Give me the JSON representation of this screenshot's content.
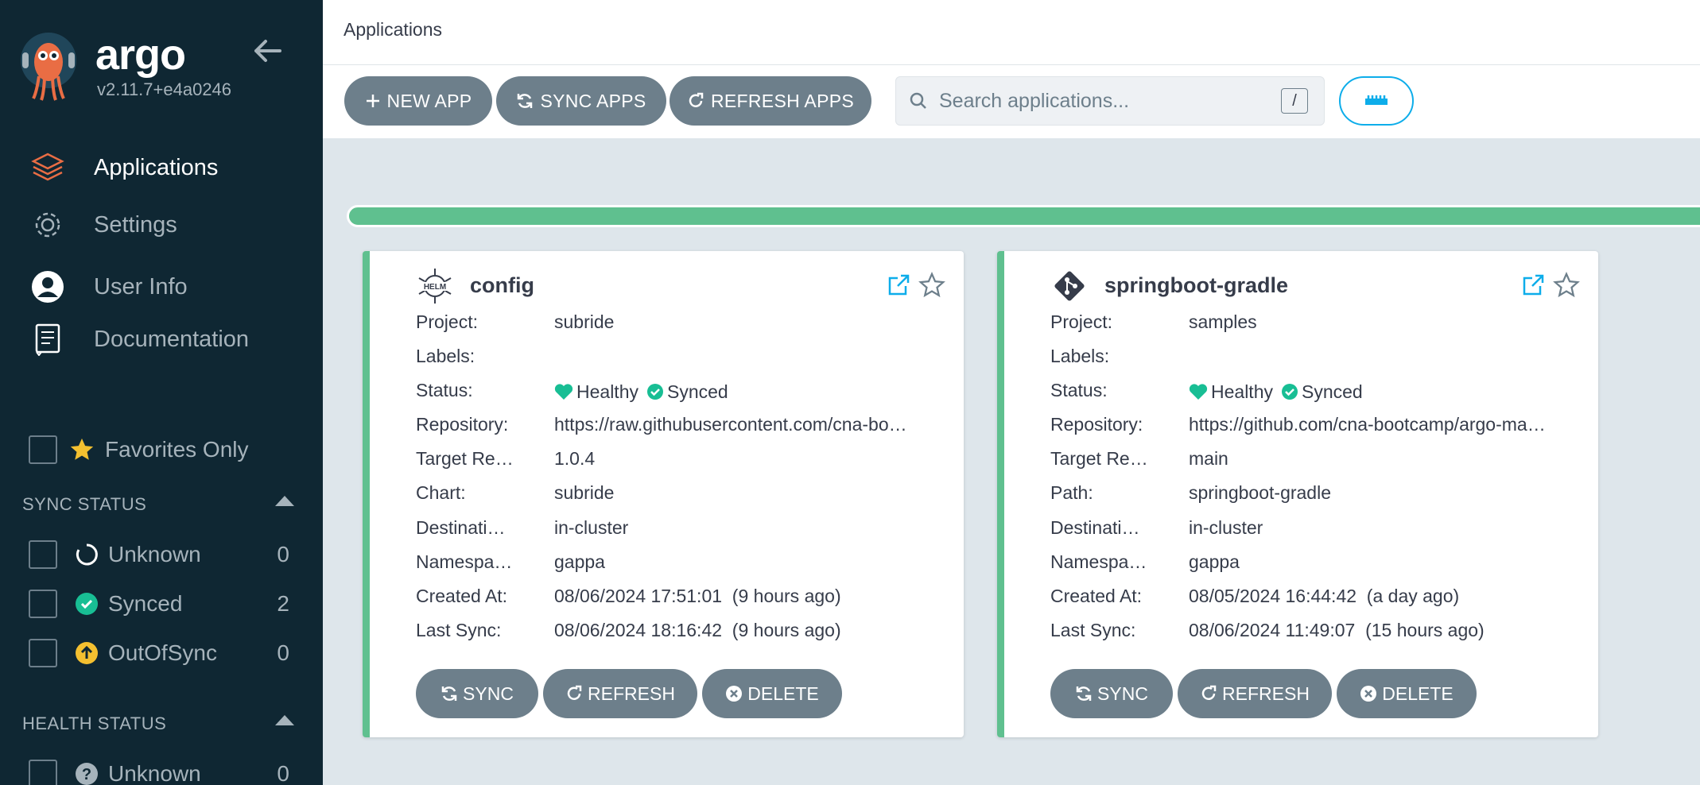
{
  "sidebar": {
    "brand": "argo",
    "version": "v2.11.7+e4a0246",
    "nav": [
      {
        "label": "Applications",
        "icon": "layers-icon"
      },
      {
        "label": "Settings",
        "icon": "gear-icon"
      },
      {
        "label": "User Info",
        "icon": "user-icon"
      },
      {
        "label": "Documentation",
        "icon": "book-icon"
      }
    ],
    "favorites_label": "Favorites Only",
    "sync_status": {
      "title": "SYNC STATUS",
      "items": [
        {
          "label": "Unknown",
          "count": "0",
          "icon": "circle-notch-icon"
        },
        {
          "label": "Synced",
          "count": "2",
          "icon": "check-circle-icon"
        },
        {
          "label": "OutOfSync",
          "count": "0",
          "icon": "arrow-up-circle-icon"
        }
      ]
    },
    "health_status": {
      "title": "HEALTH STATUS",
      "items": [
        {
          "label": "Unknown",
          "count": "0",
          "icon": "question-circle-icon"
        }
      ]
    }
  },
  "header": {
    "title": "Applications"
  },
  "toolbar": {
    "new_app": "NEW APP",
    "sync_apps": "SYNC APPS",
    "refresh_apps": "REFRESH APPS",
    "search_placeholder": "Search applications...",
    "search_shortcut": "/"
  },
  "colors": {
    "sidebar_bg": "#0f2733",
    "healthy": "#18be94",
    "synced": "#18be94",
    "button": "#6d7f8b",
    "accent": "#0dadea"
  },
  "apps": [
    {
      "name": "config",
      "source_icon": "helm-icon",
      "fields": [
        {
          "key": "Project:",
          "value": "subride"
        },
        {
          "key": "Labels:",
          "value": ""
        },
        {
          "key": "Status:",
          "health": "Healthy",
          "sync": "Synced"
        },
        {
          "key": "Repository:",
          "value": "https://raw.githubusercontent.com/cna-bo…"
        },
        {
          "key": "Target Re…",
          "value": "1.0.4"
        },
        {
          "key": "Chart:",
          "value": "subride"
        },
        {
          "key": "Destinati…",
          "value": "in-cluster"
        },
        {
          "key": "Namespa…",
          "value": "gappa"
        },
        {
          "key": "Created At:",
          "value": "08/06/2024 17:51:01  (9 hours ago)"
        },
        {
          "key": "Last Sync:",
          "value": "08/06/2024 18:16:42  (9 hours ago)"
        }
      ],
      "actions": {
        "sync": "SYNC",
        "refresh": "REFRESH",
        "delete": "DELETE"
      }
    },
    {
      "name": "springboot-gradle",
      "source_icon": "git-icon",
      "fields": [
        {
          "key": "Project:",
          "value": "samples"
        },
        {
          "key": "Labels:",
          "value": ""
        },
        {
          "key": "Status:",
          "health": "Healthy",
          "sync": "Synced"
        },
        {
          "key": "Repository:",
          "value": "https://github.com/cna-bootcamp/argo-ma…"
        },
        {
          "key": "Target Re…",
          "value": "main"
        },
        {
          "key": "Path:",
          "value": "springboot-gradle"
        },
        {
          "key": "Destinati…",
          "value": "in-cluster"
        },
        {
          "key": "Namespa…",
          "value": "gappa"
        },
        {
          "key": "Created At:",
          "value": "08/05/2024 16:44:42  (a day ago)"
        },
        {
          "key": "Last Sync:",
          "value": "08/06/2024 11:49:07  (15 hours ago)"
        }
      ],
      "actions": {
        "sync": "SYNC",
        "refresh": "REFRESH",
        "delete": "DELETE"
      }
    }
  ]
}
